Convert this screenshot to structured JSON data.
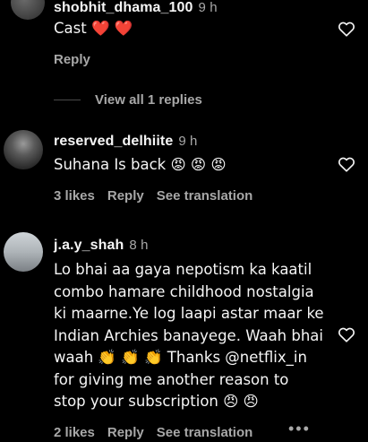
{
  "comments": [
    {
      "username": "shobhit_dhama_100",
      "time": "9 h",
      "text": "Cast ❤️ ❤️",
      "reply_label": "Reply",
      "view_replies": "View all 1 replies"
    },
    {
      "username": "reserved_delhiite",
      "time": "9 h",
      "text": "Suhana Is back 😡 😡 😡",
      "likes": "3 likes",
      "reply_label": "Reply",
      "translation_label": "See translation"
    },
    {
      "username": "j.a.y_shah",
      "time": "8 h",
      "lines": [
        "Lo bhai aa gaya nepotism ka kaatil",
        "combo hamare childhood nostalgia",
        "ki maarne.Ye log laapi astar maar ke",
        "Indian Archies banayege. Waah bhai",
        "waah 👏 👏 👏  Thanks @netflix_in",
        "for giving me another reason to",
        "stop your subscription 😠 😠"
      ],
      "likes": "2 likes",
      "reply_label": "Reply",
      "translation_label": "See translation",
      "more_label": "•••"
    }
  ],
  "colors": {
    "background": "#000000",
    "text": "#f5f5f5",
    "secondary": "#a8a8a8",
    "heart_emoji": "#e8304a",
    "angry_emoji": "#d9344a"
  }
}
